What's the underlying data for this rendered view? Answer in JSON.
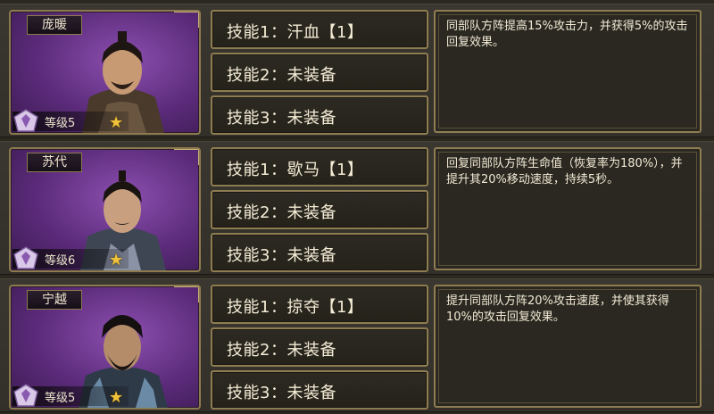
{
  "heroes": [
    {
      "name": "庞暖",
      "level": "等级5",
      "star": "★",
      "skills": [
        "技能1：汗血【1】",
        "技能2：未装备",
        "技能3：未装备"
      ],
      "description": "同部队方阵提高15%攻击力，并获得5%的攻击回复效果。"
    },
    {
      "name": "苏代",
      "level": "等级6",
      "star": "★",
      "skills": [
        "技能1：歇马【1】",
        "技能2：未装备",
        "技能3：未装备"
      ],
      "description": "回复同部队方阵生命值（恢复率为180%），并提升其20%移动速度，持续5秒。"
    },
    {
      "name": "宁越",
      "level": "等级5",
      "star": "★",
      "skills": [
        "技能1：掠夺【1】",
        "技能2：未装备",
        "技能3：未装备"
      ],
      "description": "提升同部队方阵20%攻击速度，并使其获得10%的攻击回复效果。"
    }
  ],
  "colors": {
    "portrait_bg": "#5b2b7a",
    "frame_gold": "#8f7d52",
    "star": "#f0c23a"
  },
  "icons": {
    "level_icon": "level-emblem-icon",
    "star_icon": "star-icon"
  }
}
